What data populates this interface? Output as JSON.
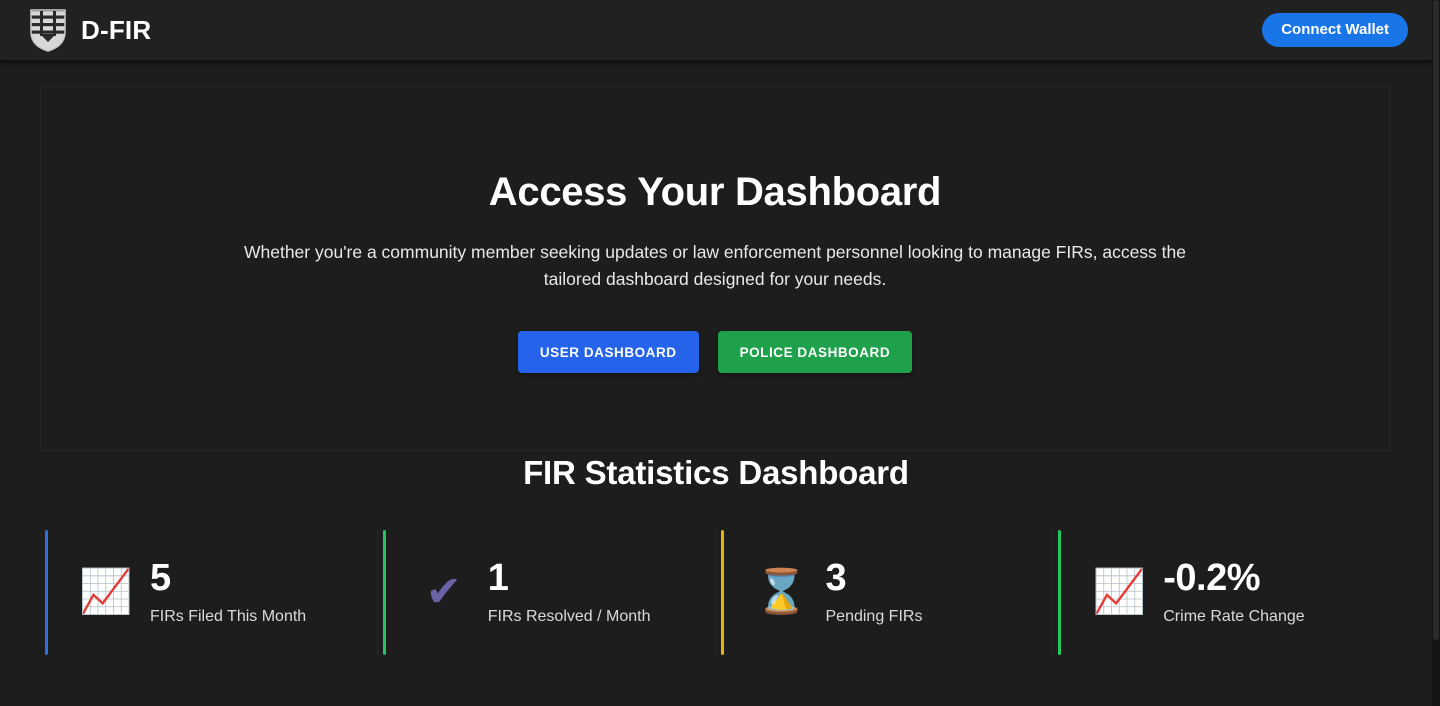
{
  "header": {
    "logo_icon": "shield-stripes-icon",
    "brand": "D-FIR",
    "connect_wallet_label": "Connect Wallet",
    "connect_wallet_color": "#1976e8"
  },
  "hero": {
    "title": "Access Your Dashboard",
    "subtitle": "Whether you're a community member seeking updates or law enforcement personnel looking to manage FIRs, access the tailored dashboard designed for your needs.",
    "buttons": [
      {
        "label": "USER DASHBOARD",
        "color": "#2563eb"
      },
      {
        "label": "POLICE DASHBOARD",
        "color": "#1fa14b"
      }
    ]
  },
  "stats": {
    "title": "FIR Statistics Dashboard",
    "cards": [
      {
        "icon": "chart-increasing-icon",
        "glyph": "📈",
        "value": "5",
        "label": "FIRs Filed This Month",
        "accent": "#2f6fe0"
      },
      {
        "icon": "check-mark-icon",
        "glyph": "✔",
        "value": "1",
        "label": "FIRs Resolved / Month",
        "accent": "#22c55e"
      },
      {
        "icon": "hourglass-icon",
        "glyph": "⌛",
        "value": "3",
        "label": "Pending FIRs",
        "accent": "#eab308"
      },
      {
        "icon": "chart-increasing-icon",
        "glyph": "📈",
        "value": "-0.2%",
        "label": "Crime Rate Change",
        "accent": "#22c55e"
      }
    ]
  }
}
